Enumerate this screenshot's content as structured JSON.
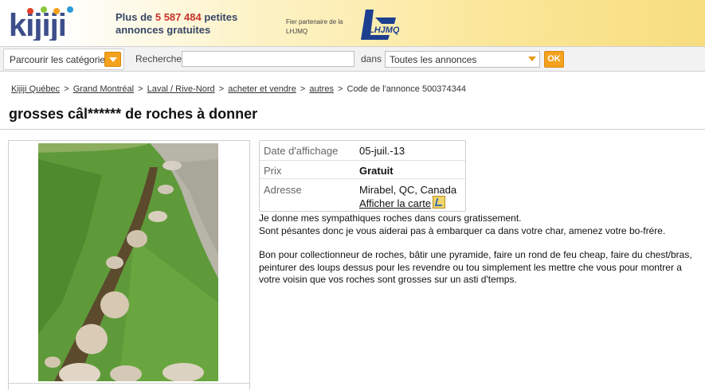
{
  "header": {
    "logo_text": "kijiji",
    "tagline_prefix": "Plus de ",
    "tagline_count": "5 587 484",
    "tagline_suffix": " petites",
    "tagline_line2": "annonces gratuites",
    "partner_line1": "Fier partenaire de la",
    "partner_line2": "LHJMQ",
    "partner_logo_text": "LHJMQ"
  },
  "searchbar": {
    "browse_label": "Parcourir les catégories",
    "search_label": "Rechercher",
    "search_value": "",
    "in_label": "dans",
    "scope_value": "Toutes les annonces",
    "ok_label": "OK"
  },
  "breadcrumb": {
    "items": [
      "Kijiji Québec",
      "Grand Montréal",
      "Laval / Rive-Nord",
      "acheter et vendre",
      "autres"
    ],
    "ad_code": "Code de l'annonce 500374344"
  },
  "listing": {
    "title": "grosses câl****** de roches à donner",
    "details": {
      "date_label": "Date d'affichage",
      "date_value": "05-juil.-13",
      "price_label": "Prix",
      "price_value": "Gratuit",
      "address_label": "Adresse",
      "address_value": "Mirabel, QC, Canada",
      "map_link": "Afficher la carte"
    },
    "description": [
      "Je donne mes sympathiques roches dans cours gratissement.",
      "Sont pésantes donc je vous aiderai pas à embarquer ca dans votre char, amenez votre bo-frére.",
      "Bon pour collectionneur de roches, bâtir une pyramide, faire un rond de feu cheap, faire du chest/bras, peinturer des loups dessus pour les revendre ou tou simplement les mettre che vous pour montrer a votre voisin que vos roches sont grosses sur un asti d'temps."
    ]
  },
  "colors": {
    "accent_orange": "#f4a21d",
    "count_red": "#c8332b",
    "tagline_blue": "#374665"
  },
  "icons": {
    "browse_dropdown": "chevron-down-icon",
    "scope_dropdown": "chevron-down-icon",
    "map": "map-icon"
  }
}
